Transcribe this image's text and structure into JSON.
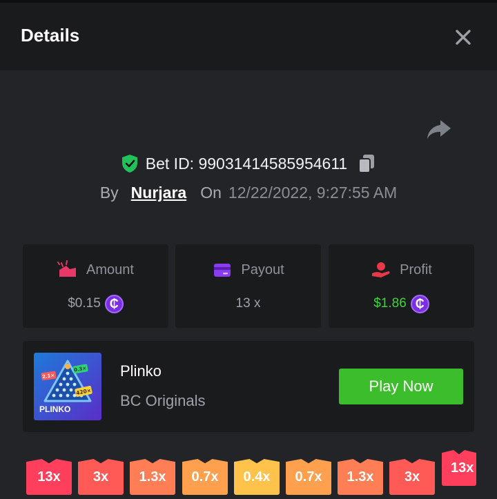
{
  "header": {
    "title": "Details"
  },
  "bet": {
    "id_text": "Bet ID: 99031414585954611",
    "by_label": "By",
    "username": "Nurjara",
    "on_label": "On",
    "datetime": "12/22/2022, 9:27:55 AM"
  },
  "stats": {
    "amount": {
      "label": "Amount",
      "value": "$0.15"
    },
    "payout": {
      "label": "Payout",
      "value": "13 x"
    },
    "profit": {
      "label": "Profit",
      "value": "$1.86",
      "color": "#3fd33a"
    }
  },
  "currency_symbol": "₵",
  "game": {
    "name": "Plinko",
    "provider": "BC Originals",
    "play_label": "Play Now",
    "thumb_title": "PLINKO",
    "thumb_badges": [
      "2.1×",
      "0.3×",
      "420×"
    ]
  },
  "multipliers": [
    {
      "label": "13x",
      "color": "#ff3f5b"
    },
    {
      "label": "3x",
      "color": "#ff5a55"
    },
    {
      "label": "1.3x",
      "color": "#ff7e55"
    },
    {
      "label": "0.7x",
      "color": "#ffa04f"
    },
    {
      "label": "0.4x",
      "color": "#ffc24a"
    },
    {
      "label": "0.7x",
      "color": "#ffa04f"
    },
    {
      "label": "1.3x",
      "color": "#ff7e55"
    },
    {
      "label": "3x",
      "color": "#ff5a55"
    },
    {
      "label": "13x",
      "color": "#ff3f5b"
    }
  ],
  "colors": {
    "accent_green": "#3cbe2c",
    "shield_green": "#22c25a",
    "coin_purple": "#7b2fe0"
  }
}
